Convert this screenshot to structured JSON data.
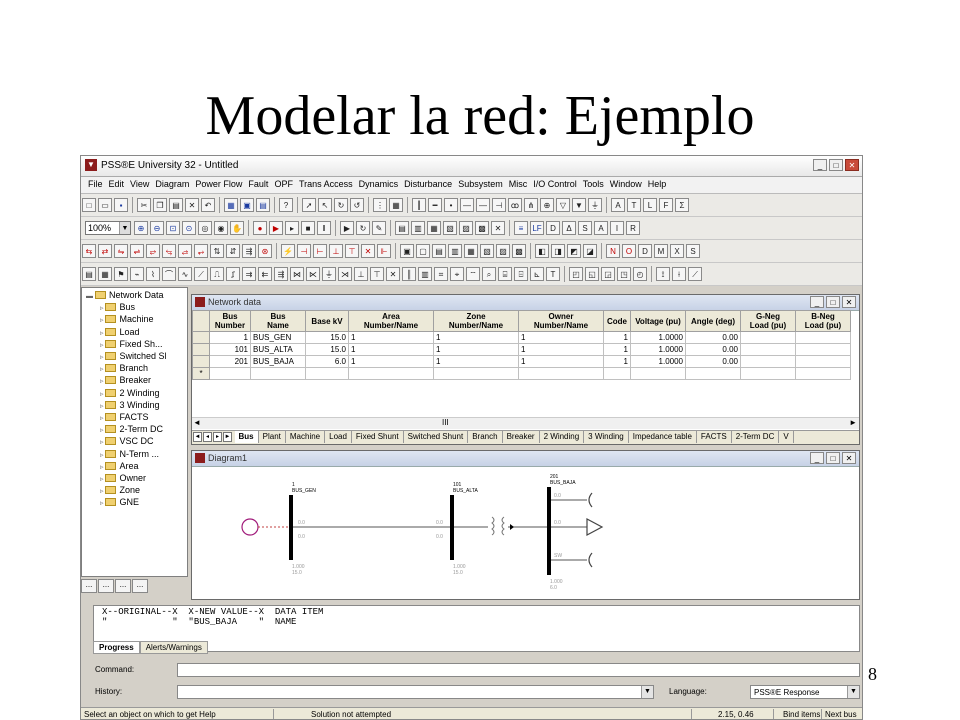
{
  "slide": {
    "title": "Modelar la red: Ejemplo",
    "page_number": "8"
  },
  "app": {
    "title": "PSS®E University 32 - Untitled",
    "menu": [
      "File",
      "Edit",
      "View",
      "Diagram",
      "Power Flow",
      "Fault",
      "OPF",
      "Trans Access",
      "Dynamics",
      "Disturbance",
      "Subsystem",
      "Misc",
      "I/O Control",
      "Tools",
      "Window",
      "Help"
    ],
    "zoom": "100%"
  },
  "tree": {
    "items": [
      {
        "label": "Network Data",
        "level": 0
      },
      {
        "label": "Bus",
        "level": 1
      },
      {
        "label": "Machine",
        "level": 1
      },
      {
        "label": "Load",
        "level": 1
      },
      {
        "label": "Fixed Sh...",
        "level": 1
      },
      {
        "label": "Switched Sl",
        "level": 1
      },
      {
        "label": "Branch",
        "level": 1
      },
      {
        "label": "Breaker",
        "level": 1
      },
      {
        "label": "2 Winding",
        "level": 1
      },
      {
        "label": "3 Winding",
        "level": 1
      },
      {
        "label": "FACTS",
        "level": 1
      },
      {
        "label": "2-Term DC",
        "level": 1
      },
      {
        "label": "VSC DC",
        "level": 1
      },
      {
        "label": "N-Term ...",
        "level": 1
      },
      {
        "label": "Area",
        "level": 1
      },
      {
        "label": "Owner",
        "level": 1
      },
      {
        "label": "Zone",
        "level": 1
      },
      {
        "label": "GNE",
        "level": 1
      }
    ],
    "bottom_tabs": [
      "...",
      "...",
      "...",
      "..."
    ]
  },
  "network_data": {
    "title": "Network data",
    "columns": [
      "Bus\nNumber",
      "Bus\nName",
      "Base kV",
      "Area\nNumber/Name",
      "Zone\nNumber/Name",
      "Owner\nNumber/Name",
      "Code",
      "Voltage (pu)",
      "Angle (deg)",
      "G-Neg\nLoad (pu)",
      "B-Neg\nLoad (pu)"
    ],
    "rows": [
      [
        "1",
        "BUS_GEN",
        "15.0",
        "1",
        "1",
        "1",
        "1",
        "1.0000",
        "0.00",
        "",
        ""
      ],
      [
        "101",
        "BUS_ALTA",
        "15.0",
        "1",
        "1",
        "1",
        "1",
        "1.0000",
        "0.00",
        "",
        ""
      ],
      [
        "201",
        "BUS_BAJA",
        "6.0",
        "1",
        "1",
        "1",
        "1",
        "1.0000",
        "0.00",
        "",
        ""
      ]
    ],
    "new_row_marker": "*",
    "scroll_marker": "III",
    "sheet_tabs": [
      "Bus",
      "Plant",
      "Machine",
      "Load",
      "Fixed Shunt",
      "Switched Shunt",
      "Branch",
      "Breaker",
      "2 Winding",
      "3 Winding",
      "Impedance table",
      "FACTS",
      "2-Term DC",
      "V"
    ]
  },
  "diagram": {
    "title": "Diagram1",
    "buses": [
      {
        "number": "1",
        "name": "BUS_GEN"
      },
      {
        "number": "101",
        "name": "BUS_ALTA"
      },
      {
        "number": "201",
        "name": "BUS_BAJA"
      }
    ],
    "small_values": [
      "0.0",
      "0.0",
      "0.0",
      "0.0",
      "1.000",
      "15.0",
      "1.000",
      "15.0",
      "1.000",
      "6.0",
      "0.0",
      "0.0",
      "SW"
    ]
  },
  "output": {
    "lines": [
      "X--ORIGINAL--X  X-NEW VALUE--X  DATA ITEM",
      "\"            \"  \"BUS_BAJA    \"  NAME"
    ],
    "tabs": [
      "Progress",
      "Alerts/Warnings"
    ]
  },
  "command": {
    "command_label": "Command:",
    "history_label": "History:",
    "language_label": "Language:",
    "language_value": "PSS®E Response"
  },
  "status": {
    "help": "Select an object on which to get Help",
    "solution": "Solution not attempted",
    "coords": "2.15, 0.46",
    "bind": "Bind items",
    "next": "Next bus"
  }
}
